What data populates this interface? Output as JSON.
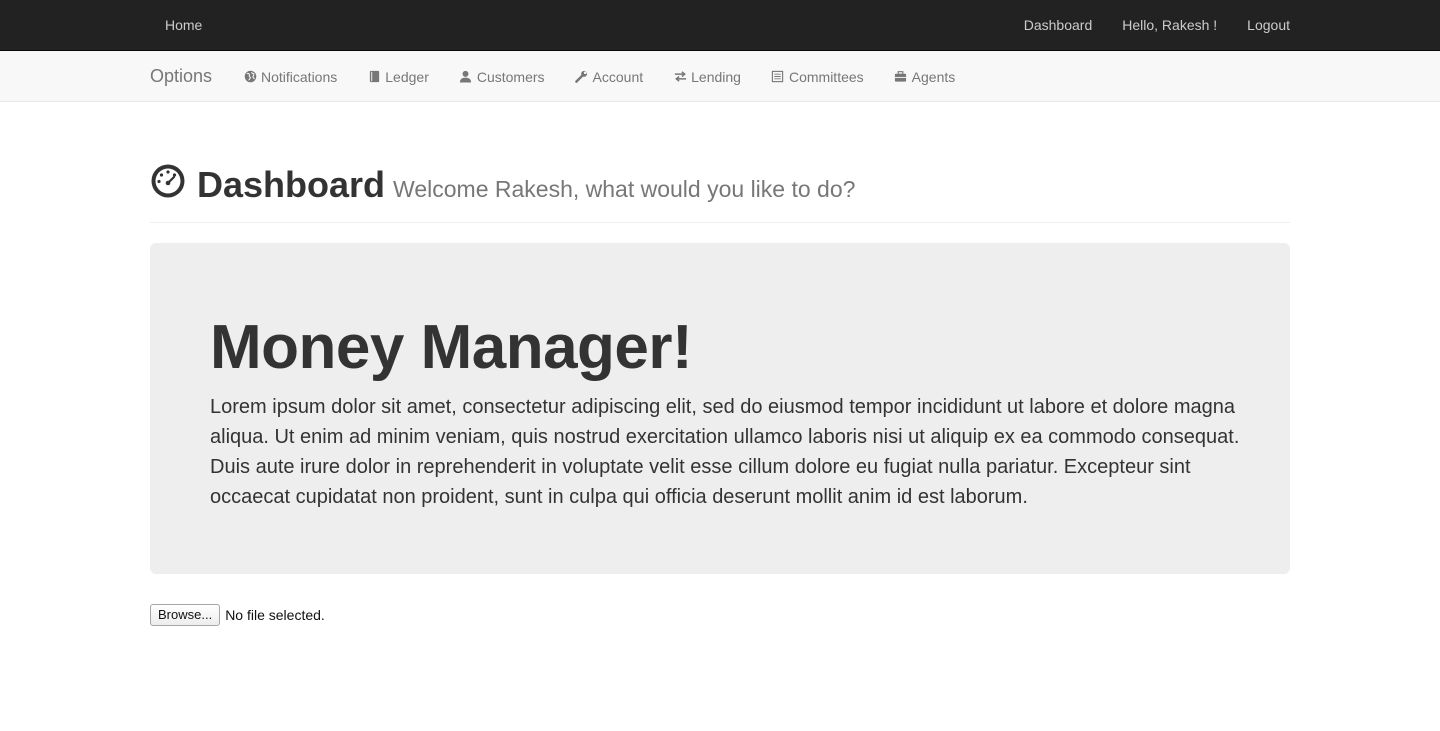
{
  "topbar": {
    "home": "Home",
    "dashboard": "Dashboard",
    "greeting": "Hello, Rakesh !",
    "logout": "Logout"
  },
  "subnav": {
    "brand": "Options",
    "items": [
      {
        "label": "Notifications",
        "icon": "globe-icon"
      },
      {
        "label": "Ledger",
        "icon": "book-icon"
      },
      {
        "label": "Customers",
        "icon": "user-icon"
      },
      {
        "label": "Account",
        "icon": "wrench-icon"
      },
      {
        "label": "Lending",
        "icon": "transfer-icon"
      },
      {
        "label": "Committees",
        "icon": "list-alt-icon"
      },
      {
        "label": "Agents",
        "icon": "briefcase-icon"
      }
    ]
  },
  "header": {
    "icon": "dashboard-icon",
    "title": "Dashboard",
    "subtitle": "Welcome Rakesh, what would you like to do?"
  },
  "jumbotron": {
    "title": "Money Manager!",
    "body": "Lorem ipsum dolor sit amet, consectetur adipiscing elit, sed do eiusmod tempor incididunt ut labore et dolore magna aliqua. Ut enim ad minim veniam, quis nostrud exercitation ullamco laboris nisi ut aliquip ex ea commodo consequat. Duis aute irure dolor in reprehenderit in voluptate velit esse cillum dolore eu fugiat nulla pariatur. Excepteur sint occaecat cupidatat non proident, sunt in culpa qui officia deserunt mollit anim id est laborum."
  },
  "file_input": {
    "button": "Browse...",
    "status": "No file selected."
  },
  "colors": {
    "topbar_bg": "#222222",
    "subnav_bg": "#f8f8f8",
    "jumbotron_bg": "#eeeeee",
    "muted_text": "#777777"
  }
}
